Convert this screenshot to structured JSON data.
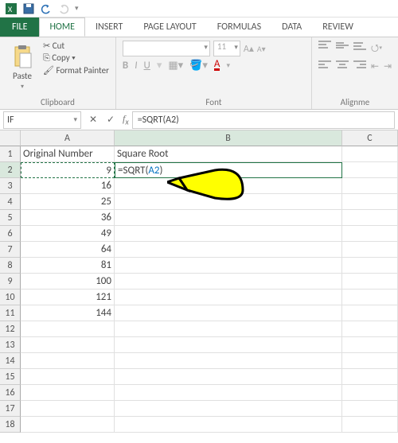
{
  "qat": {
    "save": "save",
    "undo": "undo",
    "redo": "redo"
  },
  "tabs": {
    "file": "FILE",
    "home": "HOME",
    "insert": "INSERT",
    "page_layout": "PAGE LAYOUT",
    "formulas": "FORMULAS",
    "data": "DATA",
    "review": "REVIEW"
  },
  "ribbon": {
    "clipboard": {
      "paste": "Paste",
      "cut": "Cut",
      "copy": "Copy",
      "format_painter": "Format Painter",
      "label": "Clipboard"
    },
    "font": {
      "size": "11",
      "bold": "B",
      "italic": "I",
      "underline": "U",
      "label": "Font"
    },
    "alignment": {
      "label": "Alignme"
    }
  },
  "namebox": "IF",
  "formula_bar": "=SQRT(A2)",
  "columns": [
    "A",
    "B",
    "C"
  ],
  "headers": {
    "a1": "Original Number",
    "b1": "Square Root"
  },
  "edit": {
    "prefix": "=SQRT(",
    "ref": "A2",
    "suffix": ")"
  },
  "data_rows": [
    {
      "n": 2,
      "a": "9"
    },
    {
      "n": 3,
      "a": "16"
    },
    {
      "n": 4,
      "a": "25"
    },
    {
      "n": 5,
      "a": "36"
    },
    {
      "n": 6,
      "a": "49"
    },
    {
      "n": 7,
      "a": "64"
    },
    {
      "n": 8,
      "a": "81"
    },
    {
      "n": 9,
      "a": "100"
    },
    {
      "n": 10,
      "a": "121"
    },
    {
      "n": 11,
      "a": "144"
    }
  ],
  "empty_rows": [
    12,
    13,
    14,
    15,
    16,
    17,
    18
  ],
  "chart_data": {
    "type": "table",
    "title": "Spreadsheet data",
    "columns": [
      "Original Number",
      "Square Root"
    ],
    "rows": [
      [
        9,
        null
      ],
      [
        16,
        null
      ],
      [
        25,
        null
      ],
      [
        36,
        null
      ],
      [
        49,
        null
      ],
      [
        64,
        null
      ],
      [
        81,
        null
      ],
      [
        100,
        null
      ],
      [
        121,
        null
      ],
      [
        144,
        null
      ]
    ],
    "active_formula": "=SQRT(A2)"
  }
}
